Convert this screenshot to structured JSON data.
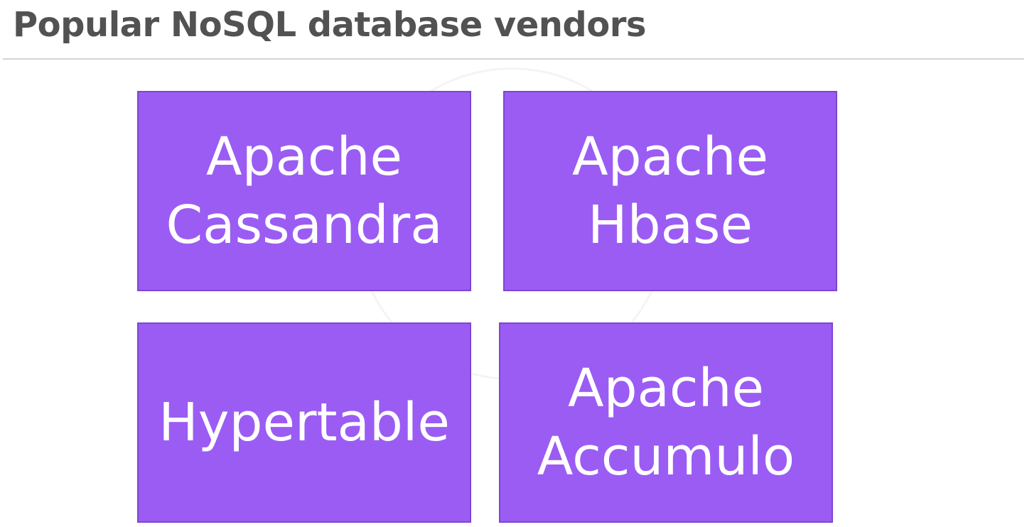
{
  "slide": {
    "title": "Popular NoSQL database vendors"
  },
  "vendors": [
    {
      "name": "Apache\nCassandra"
    },
    {
      "name": "Apache\nHbase"
    },
    {
      "name": "Hypertable"
    },
    {
      "name": "Apache\nAccumulo"
    }
  ],
  "colors": {
    "tile_fill": "#9b5cf4",
    "tile_border": "#7e45d4",
    "tile_text": "#ffffff",
    "title_text": "#525252",
    "rule": "#d2d2d8"
  }
}
